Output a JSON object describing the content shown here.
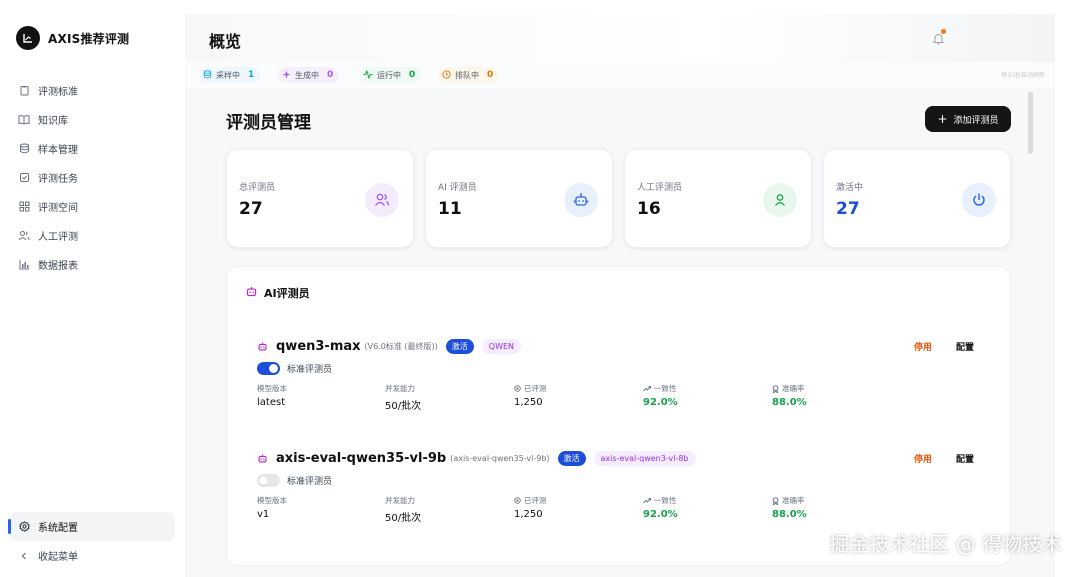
{
  "app": {
    "name": "AXIS推荐评测"
  },
  "sidebar": {
    "items": [
      {
        "label": "评测标准",
        "icon": "clipboard-icon"
      },
      {
        "label": "知识库",
        "icon": "book-icon"
      },
      {
        "label": "样本管理",
        "icon": "database-icon"
      },
      {
        "label": "评测任务",
        "icon": "checkbox-icon"
      },
      {
        "label": "评测空间",
        "icon": "grid-icon"
      },
      {
        "label": "人工评测",
        "icon": "users-icon"
      },
      {
        "label": "数据报表",
        "icon": "bar-chart-icon"
      }
    ],
    "bottom": [
      {
        "label": "系统配置",
        "icon": "gear-icon",
        "active": true
      },
      {
        "label": "收起菜单",
        "icon": "chevron-left-icon"
      }
    ]
  },
  "header": {
    "title": "概览"
  },
  "statusbar": {
    "chips": [
      {
        "label": "采样中",
        "value": "1",
        "color": "#0ea5e9",
        "bg": "#eef7fd"
      },
      {
        "label": "生成中",
        "value": "0",
        "color": "#a855f7",
        "bg": "#f6f0fd"
      },
      {
        "label": "运行中",
        "value": "0",
        "color": "#16a34a",
        "bg": "#eefaf2"
      },
      {
        "label": "排队中",
        "value": "0",
        "color": "#d97706",
        "bg": "#fdf6ea"
      }
    ],
    "refresh_note": "每10秒自动刷新"
  },
  "main": {
    "title": "评测员管理",
    "add_button": "添加评测员",
    "stats": [
      {
        "label": "总评测员",
        "value": "27",
        "icon": "users-icon",
        "icon_color": "#a855f7",
        "icon_bg": "#f4ecfd",
        "value_color": "#111111"
      },
      {
        "label": "AI 评测员",
        "value": "11",
        "icon": "robot-icon",
        "icon_color": "#2563eb",
        "icon_bg": "#e8f0fd",
        "value_color": "#111111"
      },
      {
        "label": "人工评测员",
        "value": "16",
        "icon": "user-icon",
        "icon_color": "#16a34a",
        "icon_bg": "#e7f7ec",
        "value_color": "#111111"
      },
      {
        "label": "激活中",
        "value": "27",
        "icon": "power-icon",
        "icon_color": "#2563eb",
        "icon_bg": "#e8f0fd",
        "value_color": "#1d4ed8"
      }
    ],
    "panel": {
      "title": "AI评测员",
      "evaluators": [
        {
          "name": "qwen3-max",
          "subtitle": "(V6.0标准 (最终版))",
          "status": "激活",
          "model": "QWEN",
          "standard_label": "标准评测员",
          "standard_on": true,
          "actions": {
            "disable": "停用",
            "config": "配置"
          },
          "metrics": [
            {
              "label": "模型版本",
              "value": "latest"
            },
            {
              "label": "并发能力",
              "value": "50/批次"
            },
            {
              "label": "已评测",
              "value": "1,250"
            },
            {
              "label": "一致性",
              "value": "92.0%"
            },
            {
              "label": "准确率",
              "value": "88.0%"
            }
          ]
        },
        {
          "name": "axis-eval-qwen35-vl-9b",
          "subtitle": "(axis-eval-qwen35-vl-9b)",
          "status": "激活",
          "model": "axis-eval-qwen3-vl-8b",
          "standard_label": "标准评测员",
          "standard_on": false,
          "actions": {
            "disable": "停用",
            "config": "配置"
          },
          "metrics": [
            {
              "label": "模型版本",
              "value": "v1"
            },
            {
              "label": "并发能力",
              "value": "50/批次"
            },
            {
              "label": "已评测",
              "value": "1,250"
            },
            {
              "label": "一致性",
              "value": "92.0%"
            },
            {
              "label": "准确率",
              "value": "88.0%"
            }
          ]
        }
      ]
    }
  },
  "watermark": "掘金技术社区 @ 得物技术"
}
